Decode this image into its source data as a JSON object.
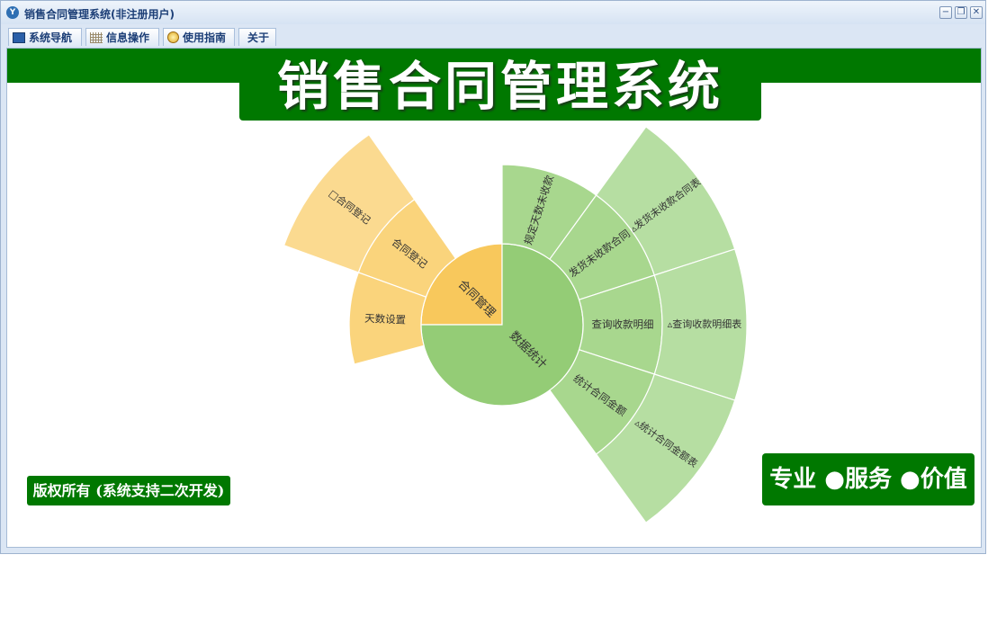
{
  "window": {
    "title": "销售合同管理系统(非注册用户)",
    "app_icon": "Y",
    "minimize_glyph": "−",
    "restore_glyph": "❐",
    "close_glyph": "✕"
  },
  "menu": {
    "items": [
      {
        "label": "系统导航",
        "icon": "monitor-icon"
      },
      {
        "label": "信息操作",
        "icon": "grid-icon"
      },
      {
        "label": "使用指南",
        "icon": "help-icon"
      },
      {
        "label": "关于",
        "icon": ""
      }
    ]
  },
  "banner": {
    "title": "销售合同管理系统"
  },
  "copyright": "版权所有 (系统支持二次开发)",
  "slogan": "专业 ●服务 ●价值",
  "sunburst": {
    "colors": {
      "orange_inner": "#F8C85C",
      "orange_mid": "#FAD47C",
      "orange_outer": "#FBDA90",
      "green_inner": "#94CC76",
      "green_mid": "#A8D78E",
      "green_outer": "#B6DEA2",
      "border": "#ffffff"
    },
    "center": {
      "contract": "合同管理",
      "stats": "数据统计"
    },
    "ring2": {
      "contract_register": "合同登记",
      "days_setting": "天数设置",
      "overdue": "规定天数未收款",
      "shipped_unpaid": "发货未收款合同",
      "query_detail": "查询收款明细",
      "contract_amount": "统计合同金额"
    },
    "ring3": {
      "contract_register": "□合同登记",
      "shipped_unpaid_table": "▵发货未收款合同表",
      "query_detail_table": "▵查询收款明细表",
      "contract_amount_table": "▵统计合同金额表"
    }
  }
}
